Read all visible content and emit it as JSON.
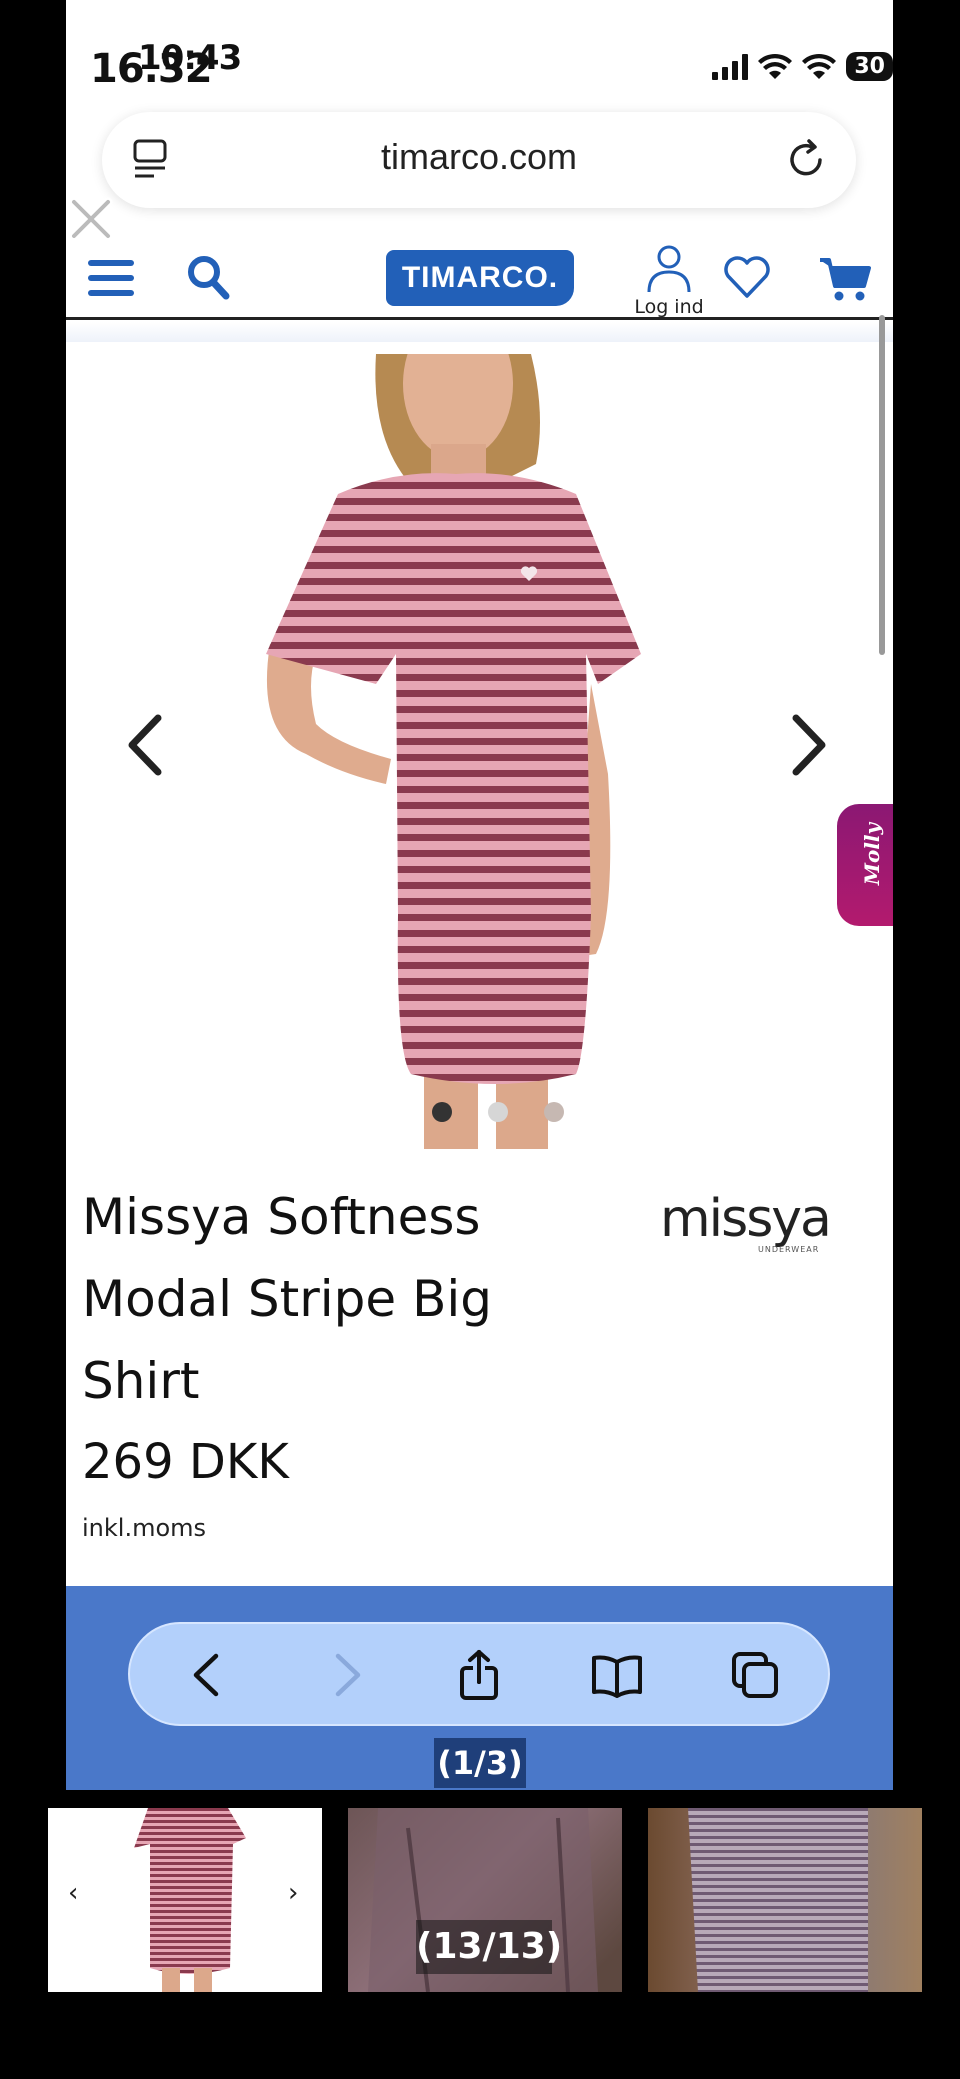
{
  "status_bar": {
    "time": "16.32",
    "time_overlay": "10:43",
    "battery": "30"
  },
  "browser": {
    "url": "timarco.com"
  },
  "site": {
    "logo_text": "TIMARCO.",
    "login_label": "Log ind",
    "chat_tab_label": "Molly",
    "brand_color": "#2260b8",
    "chat_tab_color": "#a31a72"
  },
  "product": {
    "title_line1": "Missya Softness",
    "title_line2": "Modal Stripe Big",
    "title_line3": "Shirt",
    "price": "269 DKK",
    "vat_note": "inkl.moms",
    "brand_logo_text": "missya",
    "brand_logo_sub": "UNDERWEAR",
    "gallery_total_images": 3,
    "gallery_active_index": 1
  },
  "toolbar": {
    "bar_color": "#4a78c9",
    "pill_color": "#b3d0fb"
  },
  "viewer": {
    "counter_top": "(1/3)",
    "counter_bottom": "(13/13)"
  },
  "icons": {
    "close": "close-icon",
    "menu": "menu-icon",
    "search": "search-icon",
    "user": "user-icon",
    "heart": "heart-icon",
    "cart": "cart-icon",
    "reload": "reload-icon",
    "share": "share-icon",
    "bookmarks": "bookmarks-icon",
    "tabs": "tabs-icon"
  }
}
